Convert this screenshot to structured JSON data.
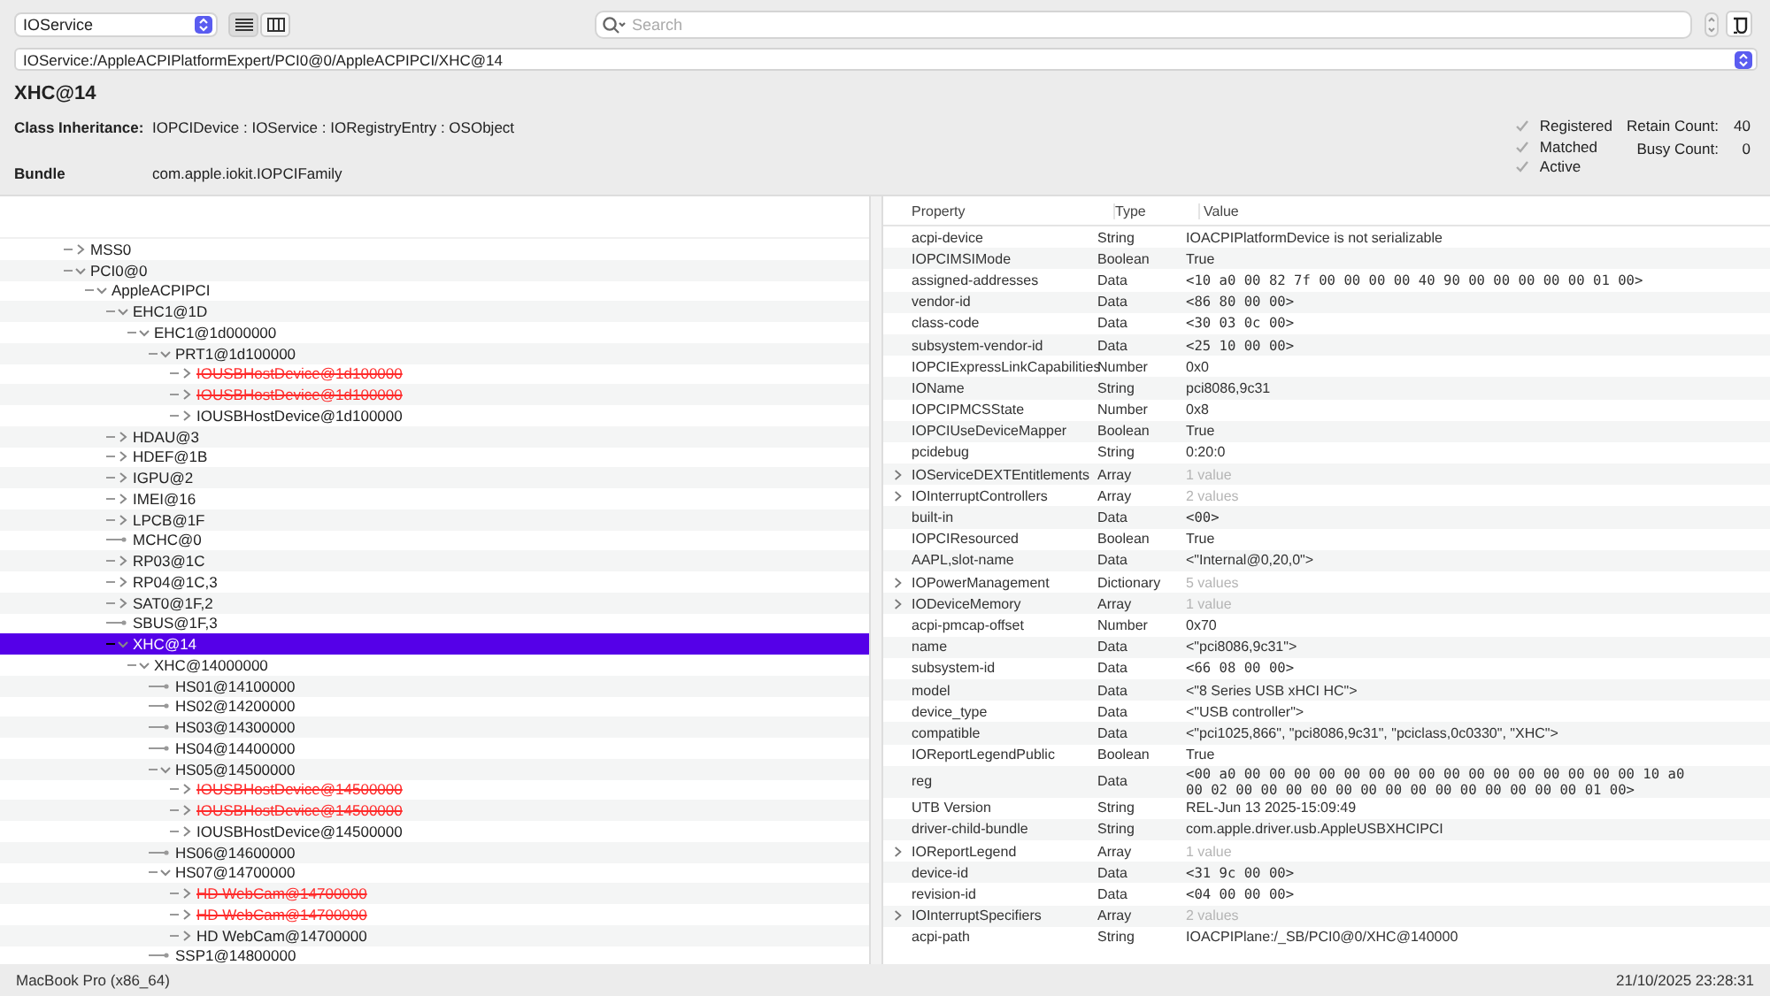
{
  "toolbar": {
    "plane": "IOService",
    "views": [
      {
        "kind": "list",
        "selected": true
      },
      {
        "kind": "columns",
        "selected": false
      }
    ],
    "search": {
      "placeholder": "Search"
    }
  },
  "path": "IOService:/AppleACPIPlatformExpert/PCI0@0/AppleACPIPCI/XHC@14",
  "entry": {
    "title": "XHC@14",
    "class_label": "Class Inheritance:",
    "class_inheritance": "IOPCIDevice : IOService : IORegistryEntry : OSObject",
    "bundle_label": "Bundle",
    "bundle": "com.apple.iokit.IOPCIFamily",
    "flags": [
      {
        "label": "Registered",
        "checked": true
      },
      {
        "label": "Matched",
        "checked": true
      },
      {
        "label": "Active",
        "checked": true
      }
    ],
    "counts": [
      {
        "label": "Retain Count:",
        "value": "40"
      },
      {
        "label": "Busy Count:",
        "value": "0"
      }
    ]
  },
  "tree": [
    {
      "name": "MSS0",
      "kind": "branch",
      "expanded": false,
      "selected": false,
      "terminated": false
    },
    {
      "name": "PCI0@0",
      "kind": "branch",
      "expanded": true,
      "selected": false,
      "terminated": false,
      "children": [
        {
          "name": "AppleACPIPCI",
          "kind": "branch",
          "expanded": true,
          "selected": false,
          "terminated": false,
          "children": [
            {
              "name": "EHC1@1D",
              "kind": "branch",
              "expanded": true,
              "selected": false,
              "terminated": false,
              "children": [
                {
                  "name": "EHC1@1d000000",
                  "kind": "branch",
                  "expanded": true,
                  "selected": false,
                  "terminated": false,
                  "children": [
                    {
                      "name": "PRT1@1d100000",
                      "kind": "branch",
                      "expanded": true,
                      "selected": false,
                      "terminated": false,
                      "children": [
                        {
                          "name": "IOUSBHostDevice@1d100000",
                          "kind": "branch",
                          "expanded": false,
                          "selected": false,
                          "terminated": true
                        },
                        {
                          "name": "IOUSBHostDevice@1d100000",
                          "kind": "branch",
                          "expanded": false,
                          "selected": false,
                          "terminated": true
                        },
                        {
                          "name": "IOUSBHostDevice@1d100000",
                          "kind": "branch",
                          "expanded": false,
                          "selected": false,
                          "terminated": false
                        }
                      ]
                    }
                  ]
                }
              ]
            },
            {
              "name": "HDAU@3",
              "kind": "branch",
              "expanded": false,
              "selected": false,
              "terminated": false
            },
            {
              "name": "HDEF@1B",
              "kind": "branch",
              "expanded": false,
              "selected": false,
              "terminated": false
            },
            {
              "name": "IGPU@2",
              "kind": "branch",
              "expanded": false,
              "selected": false,
              "terminated": false
            },
            {
              "name": "IMEI@16",
              "kind": "branch",
              "expanded": false,
              "selected": false,
              "terminated": false
            },
            {
              "name": "LPCB@1F",
              "kind": "branch",
              "expanded": false,
              "selected": false,
              "terminated": false
            },
            {
              "name": "MCHC@0",
              "kind": "leaf",
              "selected": false,
              "terminated": false
            },
            {
              "name": "RP03@1C",
              "kind": "branch",
              "expanded": false,
              "selected": false,
              "terminated": false
            },
            {
              "name": "RP04@1C,3",
              "kind": "branch",
              "expanded": false,
              "selected": false,
              "terminated": false
            },
            {
              "name": "SAT0@1F,2",
              "kind": "branch",
              "expanded": false,
              "selected": false,
              "terminated": false
            },
            {
              "name": "SBUS@1F,3",
              "kind": "leaf",
              "selected": false,
              "terminated": false
            },
            {
              "name": "XHC@14",
              "kind": "branch",
              "expanded": true,
              "selected": true,
              "terminated": false,
              "children": [
                {
                  "name": "XHC@14000000",
                  "kind": "branch",
                  "expanded": true,
                  "selected": false,
                  "terminated": false,
                  "children": [
                    {
                      "name": "HS01@14100000",
                      "kind": "leaf",
                      "selected": false,
                      "terminated": false
                    },
                    {
                      "name": "HS02@14200000",
                      "kind": "leaf",
                      "selected": false,
                      "terminated": false
                    },
                    {
                      "name": "HS03@14300000",
                      "kind": "leaf",
                      "selected": false,
                      "terminated": false
                    },
                    {
                      "name": "HS04@14400000",
                      "kind": "leaf",
                      "selected": false,
                      "terminated": false
                    },
                    {
                      "name": "HS05@14500000",
                      "kind": "branch",
                      "expanded": true,
                      "selected": false,
                      "terminated": false,
                      "children": [
                        {
                          "name": "IOUSBHostDevice@14500000",
                          "kind": "branch",
                          "expanded": false,
                          "selected": false,
                          "terminated": true
                        },
                        {
                          "name": "IOUSBHostDevice@14500000",
                          "kind": "branch",
                          "expanded": false,
                          "selected": false,
                          "terminated": true
                        },
                        {
                          "name": "IOUSBHostDevice@14500000",
                          "kind": "branch",
                          "expanded": false,
                          "selected": false,
                          "terminated": false
                        }
                      ]
                    },
                    {
                      "name": "HS06@14600000",
                      "kind": "leaf",
                      "selected": false,
                      "terminated": false
                    },
                    {
                      "name": "HS07@14700000",
                      "kind": "branch",
                      "expanded": true,
                      "selected": false,
                      "terminated": false,
                      "children": [
                        {
                          "name": "HD WebCam@14700000",
                          "kind": "branch",
                          "expanded": false,
                          "selected": false,
                          "terminated": true
                        },
                        {
                          "name": "HD WebCam@14700000",
                          "kind": "branch",
                          "expanded": false,
                          "selected": false,
                          "terminated": true
                        },
                        {
                          "name": "HD WebCam@14700000",
                          "kind": "branch",
                          "expanded": false,
                          "selected": false,
                          "terminated": false
                        }
                      ]
                    },
                    {
                      "name": "SSP1@14800000",
                      "kind": "leaf",
                      "selected": false,
                      "terminated": false
                    }
                  ]
                }
              ]
            }
          ]
        }
      ]
    }
  ],
  "properties": {
    "columns": [
      "Property",
      "Type",
      "Value"
    ],
    "rows": [
      {
        "property": "acpi-device",
        "type": "String",
        "value": "IOACPIPlatformDevice is not serializable",
        "kind": "text"
      },
      {
        "property": "IOPCIMSIMode",
        "type": "Boolean",
        "value": "True",
        "kind": "text"
      },
      {
        "property": "assigned-addresses",
        "type": "Data",
        "value": "<10 a0 00 82 7f 00 00 00 00 40 90 00 00 00 00 00 01 00>",
        "kind": "data"
      },
      {
        "property": "vendor-id",
        "type": "Data",
        "value": "<86 80 00 00>",
        "kind": "data"
      },
      {
        "property": "class-code",
        "type": "Data",
        "value": "<30 03 0c 00>",
        "kind": "data"
      },
      {
        "property": "subsystem-vendor-id",
        "type": "Data",
        "value": "<25 10 00 00>",
        "kind": "data"
      },
      {
        "property": "IOPCIExpressLinkCapabilities",
        "type": "Number",
        "value": "0x0",
        "kind": "text"
      },
      {
        "property": "IOName",
        "type": "String",
        "value": "pci8086,9c31",
        "kind": "text"
      },
      {
        "property": "IOPCIPMCSState",
        "type": "Number",
        "value": "0x8",
        "kind": "text"
      },
      {
        "property": "IOPCIUseDeviceMapper",
        "type": "Boolean",
        "value": "True",
        "kind": "text"
      },
      {
        "property": "pcidebug",
        "type": "String",
        "value": "0:20:0",
        "kind": "text"
      },
      {
        "property": "IOServiceDEXTEntitlements",
        "type": "Array",
        "value": "1 value",
        "kind": "collection"
      },
      {
        "property": "IOInterruptControllers",
        "type": "Array",
        "value": "2 values",
        "kind": "collection"
      },
      {
        "property": "built-in",
        "type": "Data",
        "value": "<00>",
        "kind": "data"
      },
      {
        "property": "IOPCIResourced",
        "type": "Boolean",
        "value": "True",
        "kind": "text"
      },
      {
        "property": "AAPL,slot-name",
        "type": "Data",
        "value": "<\"Internal@0,20,0\">",
        "kind": "text"
      },
      {
        "property": "IOPowerManagement",
        "type": "Dictionary",
        "value": "5 values",
        "kind": "collection"
      },
      {
        "property": "IODeviceMemory",
        "type": "Array",
        "value": "1 value",
        "kind": "collection"
      },
      {
        "property": "acpi-pmcap-offset",
        "type": "Number",
        "value": "0x70",
        "kind": "text"
      },
      {
        "property": "name",
        "type": "Data",
        "value": "<\"pci8086,9c31\">",
        "kind": "text"
      },
      {
        "property": "subsystem-id",
        "type": "Data",
        "value": "<66 08 00 00>",
        "kind": "data"
      },
      {
        "property": "model",
        "type": "Data",
        "value": "<\"8 Series USB xHCI HC\">",
        "kind": "text"
      },
      {
        "property": "device_type",
        "type": "Data",
        "value": "<\"USB controller\">",
        "kind": "text"
      },
      {
        "property": "compatible",
        "type": "Data",
        "value": "<\"pci1025,866\", \"pci8086,9c31\", \"pciclass,0c0330\", \"XHC\">",
        "kind": "text"
      },
      {
        "property": "IOReportLegendPublic",
        "type": "Boolean",
        "value": "True",
        "kind": "text"
      },
      {
        "property": "reg",
        "type": "Data",
        "value": "<00 a0 00 00 00 00 00 00 00 00 00 00 00 00 00 00 00 00 10 a0 00 02 00 00 00 00 00 00 00 00 00 00 00 00 00 00 01 00>",
        "kind": "data"
      },
      {
        "property": "UTB Version",
        "type": "String",
        "value": "REL-Jun 13 2025-15:09:49",
        "kind": "text"
      },
      {
        "property": "driver-child-bundle",
        "type": "String",
        "value": "com.apple.driver.usb.AppleUSBXHCIPCI",
        "kind": "text"
      },
      {
        "property": "IOReportLegend",
        "type": "Array",
        "value": "1 value",
        "kind": "collection"
      },
      {
        "property": "device-id",
        "type": "Data",
        "value": "<31 9c 00 00>",
        "kind": "data"
      },
      {
        "property": "revision-id",
        "type": "Data",
        "value": "<04 00 00 00>",
        "kind": "data"
      },
      {
        "property": "IOInterruptSpecifiers",
        "type": "Array",
        "value": "2 values",
        "kind": "collection"
      },
      {
        "property": "acpi-path",
        "type": "String",
        "value": "IOACPIPlane:/_SB/PCI0@0/XHC@140000",
        "kind": "text"
      }
    ]
  },
  "status_bar": {
    "machine": "MacBook Pro (x86_64)",
    "timestamp": "21/10/2025 23:28:31"
  }
}
